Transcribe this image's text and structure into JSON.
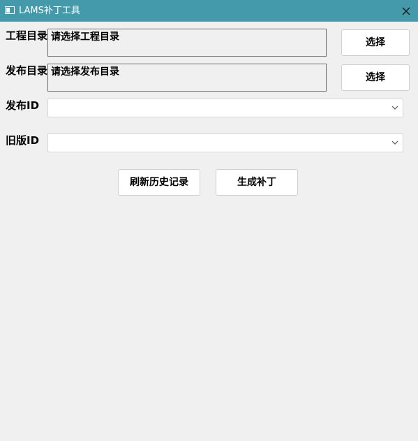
{
  "window": {
    "title": "LAMS补丁工具",
    "icons": {
      "app": "window-icon",
      "close": "close-icon"
    }
  },
  "form": {
    "project_dir": {
      "label": "工程目录",
      "value": "请选择工程目录",
      "button": "选择"
    },
    "publish_dir": {
      "label": "发布目录",
      "value": "请选择发布目录",
      "button": "选择"
    },
    "publish_id": {
      "label": "发布ID",
      "selected": ""
    },
    "old_id": {
      "label": "旧版ID",
      "selected": ""
    }
  },
  "actions": {
    "refresh_label": "刷新历史记录",
    "generate_label": "生成补丁"
  },
  "colors": {
    "titlebar": "#4499ab",
    "background": "#f0f0f0",
    "button": "#ffffff"
  }
}
